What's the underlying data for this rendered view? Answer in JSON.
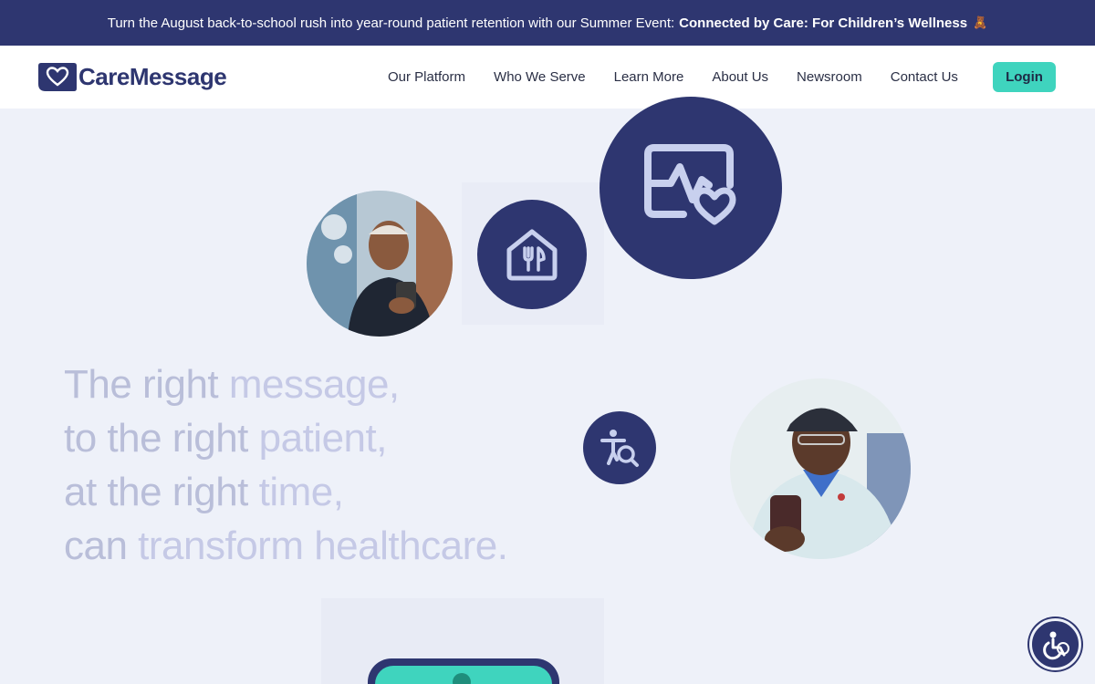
{
  "banner": {
    "text": "Turn the August back-to-school rush into year-round patient retention with our Summer Event:",
    "event_name": "Connected by Care: For Children’s Wellness",
    "emoji": "🧸"
  },
  "header": {
    "logo_text": "CareMessage",
    "nav": [
      {
        "label": "Our Platform"
      },
      {
        "label": "Who We Serve"
      },
      {
        "label": "Learn More"
      },
      {
        "label": "About Us"
      },
      {
        "label": "Newsroom"
      },
      {
        "label": "Contact Us"
      }
    ],
    "login_label": "Login"
  },
  "hero": {
    "lines": [
      {
        "plain": "The right ",
        "highlight": "message,"
      },
      {
        "plain": "to the right ",
        "highlight": "patient,"
      },
      {
        "plain": "at the right ",
        "highlight": "time,"
      },
      {
        "plain": "can ",
        "highlight": "transform healthcare."
      }
    ],
    "icons": [
      "food-home-icon",
      "vitals-heart-icon",
      "accessibility-search-icon"
    ],
    "photos": [
      "older-man-with-phone-photo",
      "man-in-cap-with-phone-photo"
    ]
  },
  "colors": {
    "navy": "#2e3670",
    "teal": "#3fd4be",
    "background": "#eef1f9",
    "headline": "#b9bed9"
  },
  "widgets": {
    "accessibility_button": "accessibility-widget-icon"
  }
}
